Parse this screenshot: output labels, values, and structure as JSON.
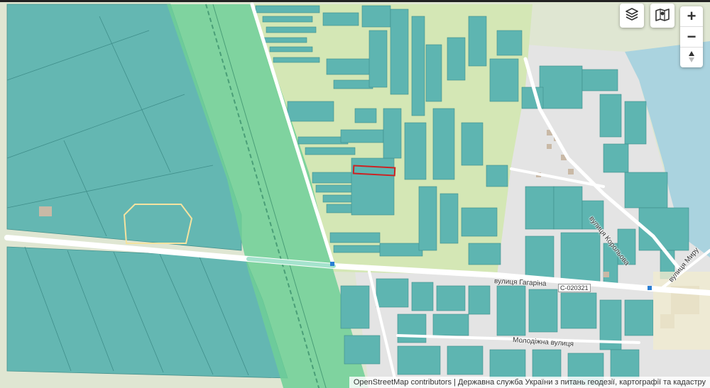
{
  "controls": {
    "layers_icon": "layers-icon",
    "map_icon": "map-icon",
    "zoom_in": "+",
    "zoom_out": "−",
    "compass": "▲▼"
  },
  "labels": {
    "gagarina": "вулиця Гагаріна",
    "road_code": "С-020321",
    "koroleva": "вулиця Корольова",
    "myru": "вулиця Миру",
    "molodizhna": "Молодіжна вулиця"
  },
  "attribution": {
    "osm": "OpenStreetMap contributors",
    "separator": " | ",
    "cadastre": "Державна служба України з питань геодезії, картографії та кадастру"
  },
  "colors": {
    "parcel_fill": "#5eb5b1",
    "green_belt": "#6fcf97",
    "residential": "#e3e3e3",
    "farmland": "#d7e9b8",
    "water": "#aad3df",
    "selected_parcel": "#cc2222"
  }
}
